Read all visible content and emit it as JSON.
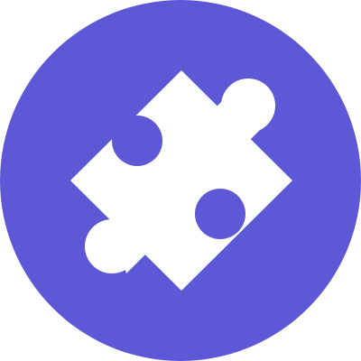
{
  "logo": {
    "icon": "puzzle-piece-icon",
    "background_color": "#5c58d6",
    "foreground_color": "#ffffff"
  }
}
